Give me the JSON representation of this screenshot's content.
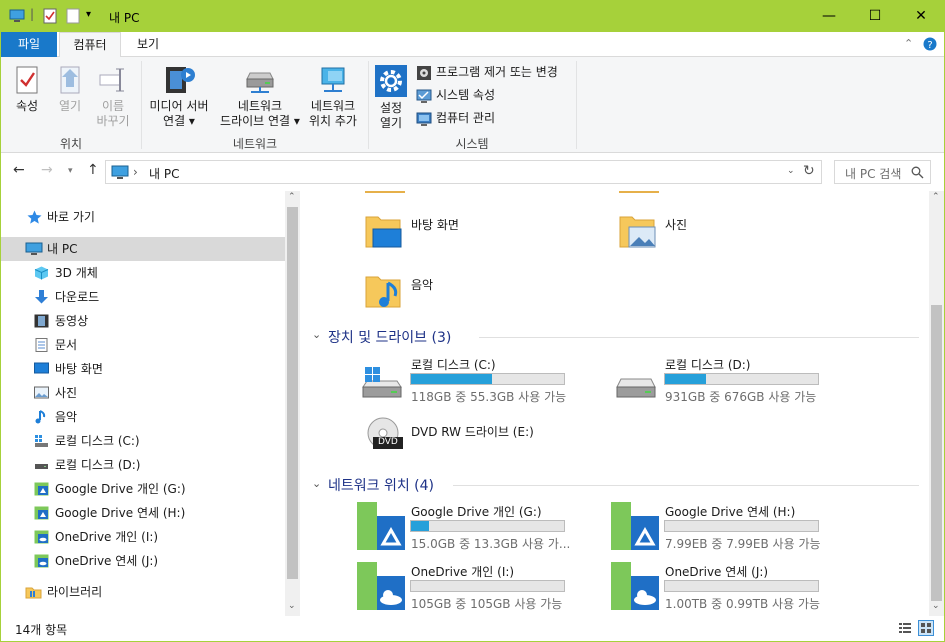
{
  "window": {
    "title": "내 PC"
  },
  "tabs": {
    "file": "파일",
    "computer": "컴퓨터",
    "view": "보기"
  },
  "ribbon": {
    "properties": "속성",
    "open": "열기",
    "rename_1": "이름",
    "rename_2": "바꾸기",
    "group_location": "위치",
    "media_1": "미디어 서버",
    "media_2": "연결 ▾",
    "mapdrive_1": "네트워크",
    "mapdrive_2": "드라이브 연결 ▾",
    "addloc_1": "네트워크",
    "addloc_2": "위치 추가",
    "group_network": "네트워크",
    "settings_1": "설정",
    "settings_2": "열기",
    "uninstall": "프로그램 제거 또는 변경",
    "sysprops": "시스템 속성",
    "manage": "컴퓨터 관리",
    "group_system": "시스템"
  },
  "address": {
    "path": "내 PC",
    "search_placeholder": "내 PC 검색"
  },
  "sidebar": {
    "items": [
      {
        "label": "바로 가기"
      },
      {
        "label": "내 PC"
      },
      {
        "label": "3D 개체"
      },
      {
        "label": "다운로드"
      },
      {
        "label": "동영상"
      },
      {
        "label": "문서"
      },
      {
        "label": "바탕 화면"
      },
      {
        "label": "사진"
      },
      {
        "label": "음악"
      },
      {
        "label": "로컬 디스크 (C:)"
      },
      {
        "label": "로컬 디스크 (D:)"
      },
      {
        "label": "Google Drive 개인 (G:)"
      },
      {
        "label": "Google Drive 연세 (H:)"
      },
      {
        "label": "OneDrive 개인 (I:)"
      },
      {
        "label": "OneDrive 연세 (J:)"
      },
      {
        "label": "라이브러리"
      }
    ]
  },
  "folders": [
    {
      "name": "바탕 화면"
    },
    {
      "name": "사진"
    },
    {
      "name": "음악"
    }
  ],
  "sections": {
    "devices": "장치 및 드라이브 (3)",
    "network": "네트워크 위치 (4)"
  },
  "drives": [
    {
      "name": "로컬 디스크 (C:)",
      "caption": "118GB 중 55.3GB 사용 가능",
      "used_fraction": 0.53
    },
    {
      "name": "로컬 디스크 (D:)",
      "caption": "931GB 중 676GB 사용 가능",
      "used_fraction": 0.27
    },
    {
      "name": "DVD RW 드라이브 (E:)",
      "caption": ""
    }
  ],
  "network": [
    {
      "name": "Google Drive 개인 (G:)",
      "caption": "15.0GB 중 13.3GB 사용 가...",
      "used_fraction": 0.12
    },
    {
      "name": "Google Drive 연세 (H:)",
      "caption": "7.99EB 중 7.99EB 사용 가능",
      "used_fraction": 0.0
    },
    {
      "name": "OneDrive 개인 (I:)",
      "caption": "105GB 중 105GB 사용 가능",
      "used_fraction": 0.0
    },
    {
      "name": "OneDrive 연세 (J:)",
      "caption": "1.00TB 중 0.99TB 사용 가능",
      "used_fraction": 0.0
    }
  ],
  "dvd_label": "DVD",
  "status": {
    "count": "14개 항목"
  },
  "colors": {
    "accent": "#1979ca",
    "titlebar": "#a6d13a",
    "bar_fill": "#26a0da"
  }
}
